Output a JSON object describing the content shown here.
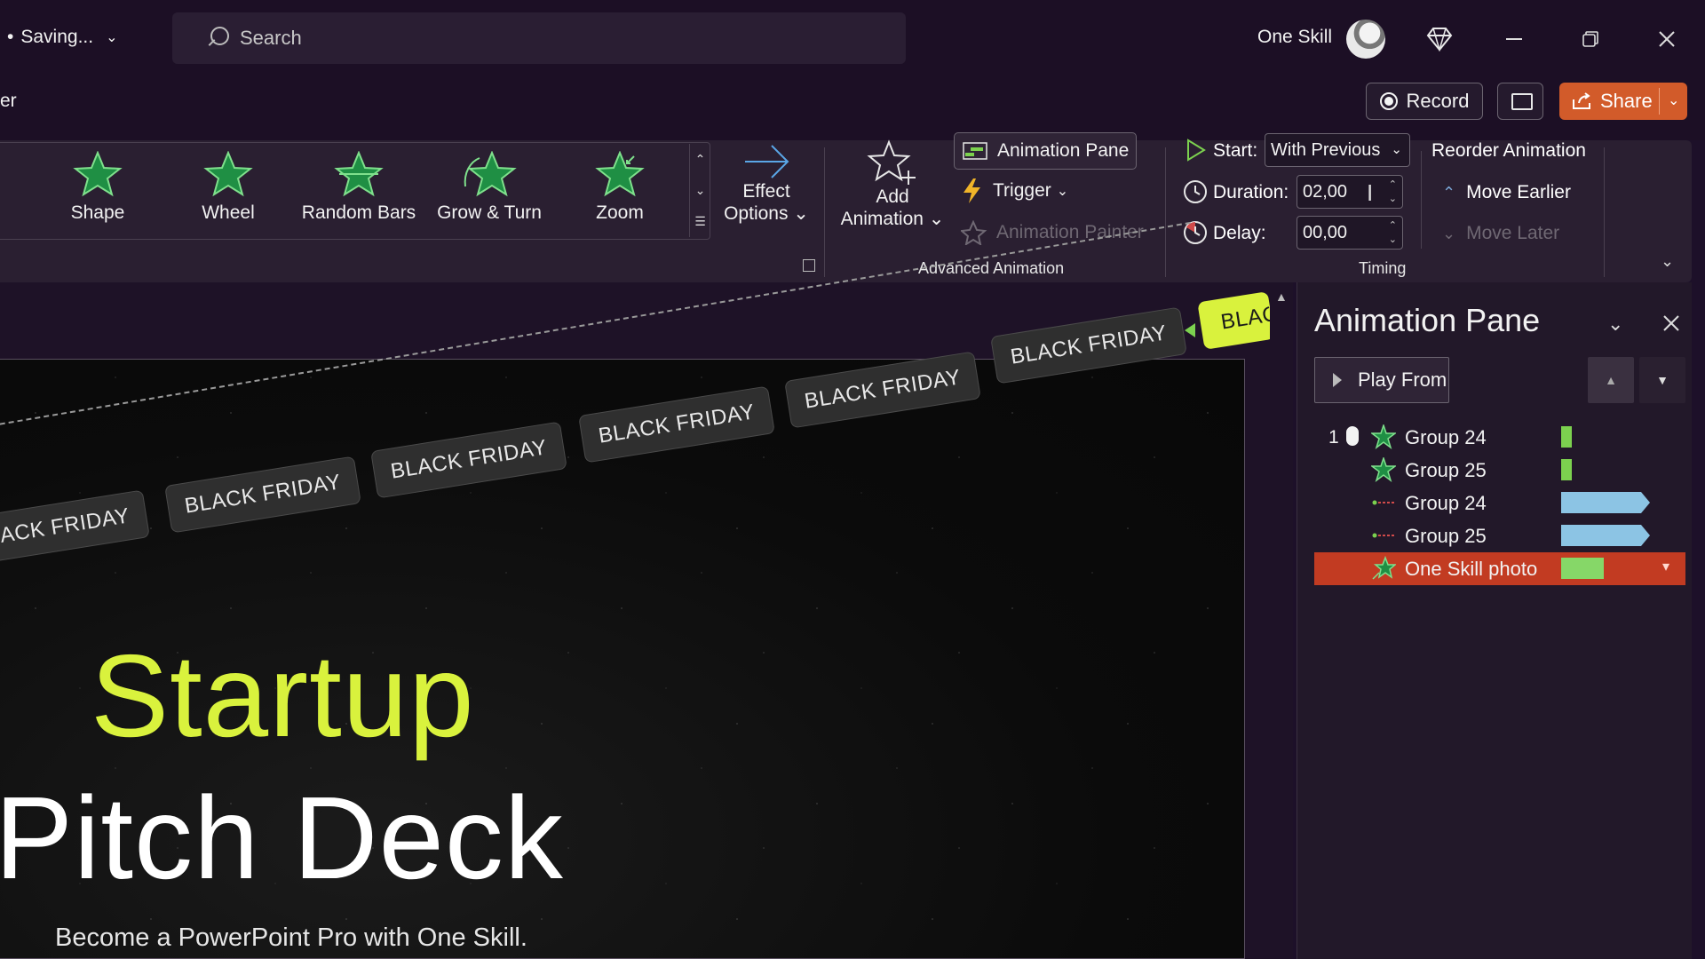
{
  "titlebar": {
    "saving_label": "Saving...",
    "search_placeholder": "Search",
    "user_name": "One Skill"
  },
  "tabbar": {
    "partial_tab": "er",
    "record_label": "Record",
    "share_label": "Share"
  },
  "ribbon": {
    "animations": [
      {
        "label": "Shape"
      },
      {
        "label": "Wheel"
      },
      {
        "label": "Random Bars"
      },
      {
        "label": "Grow & Turn"
      },
      {
        "label": "Zoom"
      }
    ],
    "effect_options": {
      "line1": "Effect",
      "line2": "Options"
    },
    "add_animation": {
      "line1": "Add",
      "line2": "Animation"
    },
    "animation_pane_label": "Animation Pane",
    "trigger_label": "Trigger",
    "animation_painter_label": "Animation Painter",
    "advanced_group_label": "Advanced Animation",
    "timing": {
      "start_label": "Start:",
      "start_value": "With Previous",
      "duration_label": "Duration:",
      "duration_value": "02,00",
      "delay_label": "Delay:",
      "delay_value": "00,00",
      "group_label": "Timing"
    },
    "reorder": {
      "title": "Reorder Animation",
      "move_earlier": "Move Earlier",
      "move_later": "Move Later"
    }
  },
  "slide": {
    "title_line1": "Startup",
    "title_line2": "Pitch Deck",
    "subtitle": "Become a PowerPoint Pro with One Skill.",
    "ticker_chips": [
      "BLACK FRIDAY",
      "BLACK FRIDAY",
      "BLACK FRIDAY",
      "BLACK FRIDAY",
      "BLACK FRIDAY",
      "BLACK FRIDAY"
    ],
    "ticker_partial_left": "BLACK FRIDAY",
    "ticker_green_partial": "BLAC"
  },
  "animation_pane": {
    "title": "Animation Pane",
    "play_from_label": "Play From",
    "items": [
      {
        "number": "1",
        "name": "Group 24",
        "kind": "emphasis"
      },
      {
        "number": "",
        "name": "Group 25",
        "kind": "emphasis"
      },
      {
        "number": "",
        "name": "Group 24",
        "kind": "motion"
      },
      {
        "number": "",
        "name": "Group 25",
        "kind": "motion"
      },
      {
        "number": "",
        "name": "One Skill photo",
        "kind": "entrance",
        "selected": true
      }
    ]
  },
  "colors": {
    "accent_green": "#d9f23d",
    "share_orange": "#d25b2a",
    "selected_row": "#c23b22",
    "motion_bar": "#8cc4e4"
  }
}
